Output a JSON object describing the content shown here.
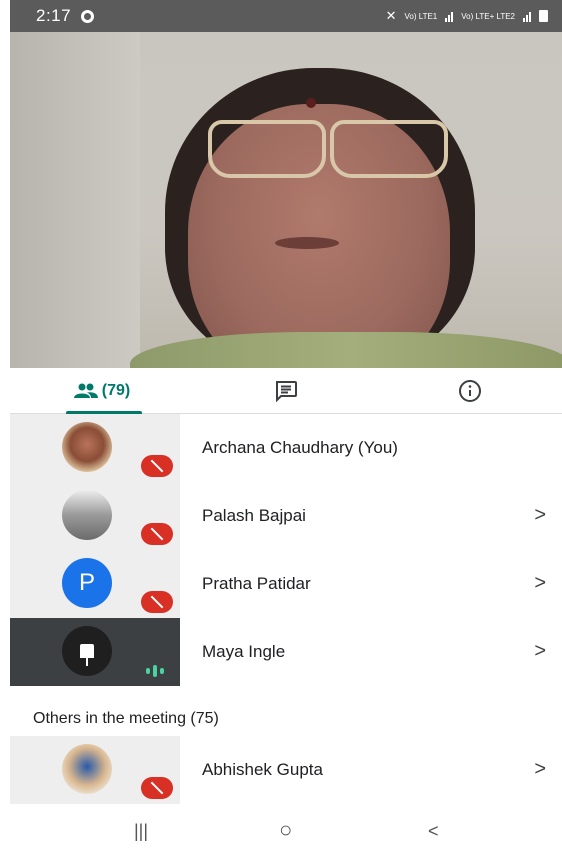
{
  "status_bar": {
    "time": "2:17",
    "network_1": "Vo) LTE1",
    "network_2": "Vo) LTE+ LTE2"
  },
  "tabs": {
    "people_count": "(79)"
  },
  "participants": [
    {
      "name": "Archana Chaudhary (You)",
      "muted": true
    },
    {
      "name": "Palash Bajpai",
      "muted": true
    },
    {
      "name": "Pratha Patidar",
      "initial": "P",
      "muted": true
    },
    {
      "name": "Maya Ingle",
      "muted": false,
      "speaking": true
    }
  ],
  "others_section": {
    "title": "Others in the meeting (75)"
  },
  "others": [
    {
      "name": "Abhishek Gupta",
      "muted": true
    }
  ],
  "chevron": ">",
  "nav": {
    "recents": "|||",
    "home": "○",
    "back": "<"
  },
  "colors": {
    "accent": "#00796b",
    "mute_red": "#d93025",
    "avatar_blue": "#1a73e8",
    "speaking_green": "#4cd1a2"
  }
}
